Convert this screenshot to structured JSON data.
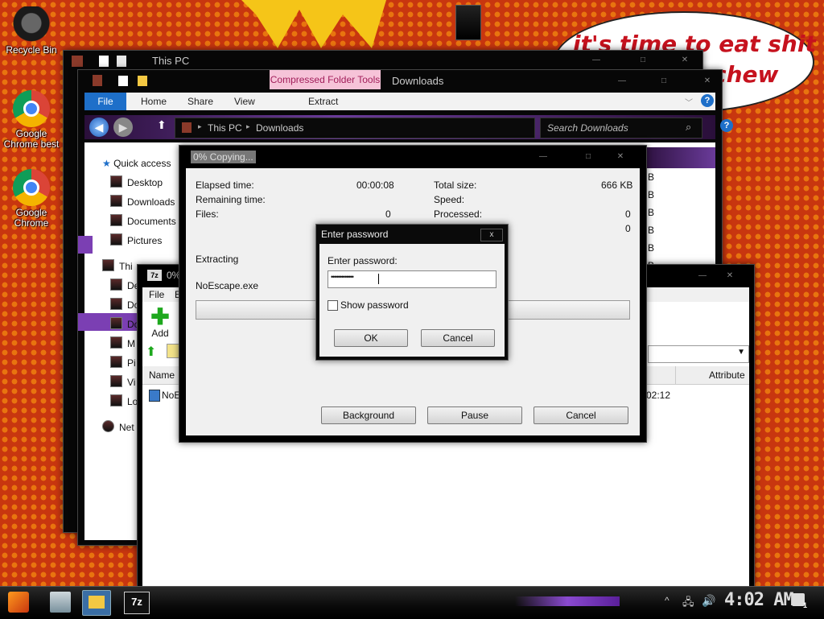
{
  "desktop": {
    "bubble_line1": "it's time to eat shit",
    "bubble_line2": "chew",
    "icons": [
      {
        "label": "Recycle Bin"
      },
      {
        "label": "Google Chrome best"
      },
      {
        "label": "Google Chrome"
      }
    ]
  },
  "back_explorer": {
    "title": "This PC"
  },
  "explorer": {
    "context_tab": "Compressed Folder Tools",
    "title": "Downloads",
    "tabs": {
      "file": "File",
      "home": "Home",
      "share": "Share",
      "view": "View",
      "extract": "Extract"
    },
    "breadcrumb": [
      "This PC",
      "Downloads"
    ],
    "search_placeholder": "Search Downloads",
    "nav": {
      "quick_access": "Quick access",
      "desktop": "Desktop",
      "downloads": "Downloads",
      "documents": "Documents",
      "pictures": "Pictures",
      "this_pc": "Thi",
      "sub": [
        "De",
        "Do",
        "Do",
        "M",
        "Pi",
        "Vi",
        "Lo"
      ],
      "network": "Net"
    },
    "size_col": [
      "B",
      "B",
      "B",
      "B",
      "B",
      "B"
    ]
  },
  "sevenzip": {
    "title": "0%",
    "menu": {
      "file": "File",
      "edit": "E"
    },
    "add_label": "Add",
    "col_name": "Name",
    "col_attributes": "Attribute",
    "row_name": "NoE",
    "row_time": "02:12"
  },
  "copy_dialog": {
    "title": "0% Copying...",
    "elapsed_label": "Elapsed time:",
    "elapsed_value": "00:00:08",
    "remaining_label": "Remaining time:",
    "files_label": "Files:",
    "files_value": "0",
    "total_label": "Total size:",
    "total_value": "666 KB",
    "speed_label": "Speed:",
    "processed_label": "Processed:",
    "processed_value": "0",
    "extra_value": "0",
    "action": "Extracting",
    "filename": "NoEscape.exe",
    "progress": 0,
    "background_btn": "Background",
    "pause_btn": "Pause",
    "cancel_btn": "Cancel"
  },
  "password_dialog": {
    "title": "Enter password",
    "close_glyph": "x",
    "prompt": "Enter password:",
    "value": "•••••••••••••",
    "show_label": "Show password",
    "ok": "OK",
    "cancel": "Cancel"
  },
  "taskbar": {
    "time": "4:02 AM",
    "zip_label": "7z",
    "notif_count": "1"
  }
}
